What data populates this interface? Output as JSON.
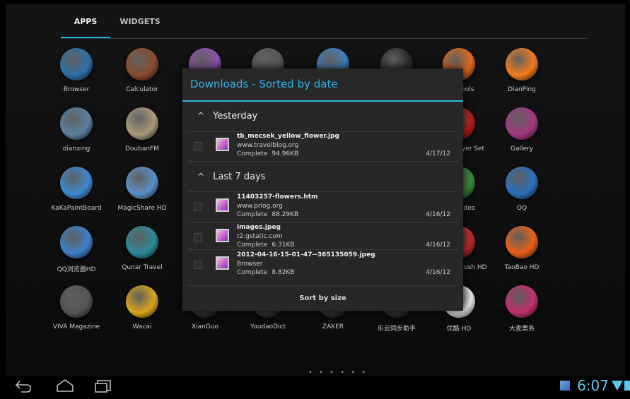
{
  "tabs": {
    "apps": "APPS",
    "widgets": "WIDGETS"
  },
  "apps": [
    {
      "label": "Browser",
      "color": "#2e6fa8",
      "icon": "globe-icon"
    },
    {
      "label": "Calculator",
      "color": "#8a4b2c",
      "icon": "calculator-icon"
    },
    {
      "label": "",
      "color": "#8e4fb0",
      "icon": "gallery-icon"
    },
    {
      "label": "",
      "color": "#555",
      "icon": "camera-icon"
    },
    {
      "label": "",
      "color": "#3f7fbf",
      "icon": "chrome-icon"
    },
    {
      "label": "",
      "color": "#2b2b2b",
      "icon": "clock-icon"
    },
    {
      "label": "Dev Tools",
      "color": "#e0661e",
      "icon": "gear-icon"
    },
    {
      "label": "DianPing",
      "color": "#f07a1e",
      "icon": "dianping-icon"
    },
    {
      "label": "dianxing",
      "color": "#5a7fa0",
      "icon": "target-icon"
    },
    {
      "label": "DoubanFM",
      "color": "#a89a7a",
      "icon": "radio-icon"
    },
    {
      "label": "Flash Player Set",
      "color": "#b81d1d",
      "icon": "flash-icon"
    },
    {
      "label": "Gallery",
      "color": "#a0397f",
      "icon": "gallery-icon"
    },
    {
      "label": "KaKaPaintBoard",
      "color": "#3d88d0",
      "icon": "paint-icon"
    },
    {
      "label": "MagicShare HD",
      "color": "#5a8fc8",
      "icon": "house-icon"
    },
    {
      "label": "QIYI Video",
      "color": "#3a8a3a",
      "icon": "qiyi-icon"
    },
    {
      "label": "QQ",
      "color": "#2b6fb8",
      "icon": "penguin-icon"
    },
    {
      "label": "QQ浏览器HD",
      "color": "#3d7fc8",
      "icon": "qq-browser-icon"
    },
    {
      "label": "Qunar Travel",
      "color": "#2a8a9a",
      "icon": "camel-icon"
    },
    {
      "label": "Straight Flush HD",
      "color": "#c42828",
      "icon": "cards-icon"
    },
    {
      "label": "TaoBao HD",
      "color": "#e86018",
      "icon": "taobao-icon"
    },
    {
      "label": "VIVA Magazine",
      "color": "#555",
      "icon": "viva-icon"
    },
    {
      "label": "Wacai",
      "color": "#d9a41c",
      "icon": "wacai-icon"
    },
    {
      "label": "XianGuo",
      "color": "#333",
      "icon": "app-icon"
    },
    {
      "label": "YoudaoDict",
      "color": "#333",
      "icon": "app-icon"
    },
    {
      "label": "ZAKER",
      "color": "#333",
      "icon": "app-icon"
    },
    {
      "label": "乐云同步助手",
      "color": "#333",
      "icon": "app-icon"
    },
    {
      "label": "优酷 HD",
      "color": "#e8e8e8",
      "icon": "youku-icon"
    },
    {
      "label": "大麦票务",
      "color": "#c03070",
      "icon": "damai-icon"
    }
  ],
  "page_dots": "• • • • • •",
  "status": {
    "time": "6:07"
  },
  "dialog": {
    "title": "Downloads - Sorted by date",
    "groups": [
      {
        "label": "Yesterday",
        "items": [
          {
            "name": "tb_mecsek_yellow_flower.jpg",
            "host": "www.travelblog.org",
            "status": "Complete",
            "size": "94.96KB",
            "date": "4/17/12"
          }
        ]
      },
      {
        "label": "Last 7 days",
        "items": [
          {
            "name": "11403257-flowers.htm",
            "host": "www.prlog.org",
            "status": "Complete",
            "size": "88.29KB",
            "date": "4/16/12"
          },
          {
            "name": "images.jpeg",
            "host": "t2.gstatic.com",
            "status": "Complete",
            "size": "6.31KB",
            "date": "4/16/12"
          },
          {
            "name": "2012-04-16-15-01-47--365135059.jpeg",
            "host": "Browser",
            "status": "Complete",
            "size": "8.82KB",
            "date": "4/16/12"
          }
        ]
      }
    ],
    "sort_button": "Sort by size"
  }
}
